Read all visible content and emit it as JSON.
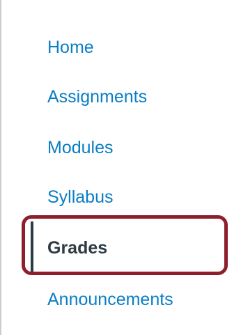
{
  "course_nav": {
    "items": [
      {
        "label": "Home",
        "state": "link"
      },
      {
        "label": "Assignments",
        "state": "link"
      },
      {
        "label": "Modules",
        "state": "link"
      },
      {
        "label": "Syllabus",
        "state": "link"
      },
      {
        "label": "Grades",
        "state": "active"
      },
      {
        "label": "Announcements",
        "state": "link"
      }
    ]
  },
  "colors": {
    "link": "#0a7ec4",
    "active_text": "#2d3b45",
    "highlight": "#8e1f2d",
    "divider": "#c7cdd1"
  }
}
